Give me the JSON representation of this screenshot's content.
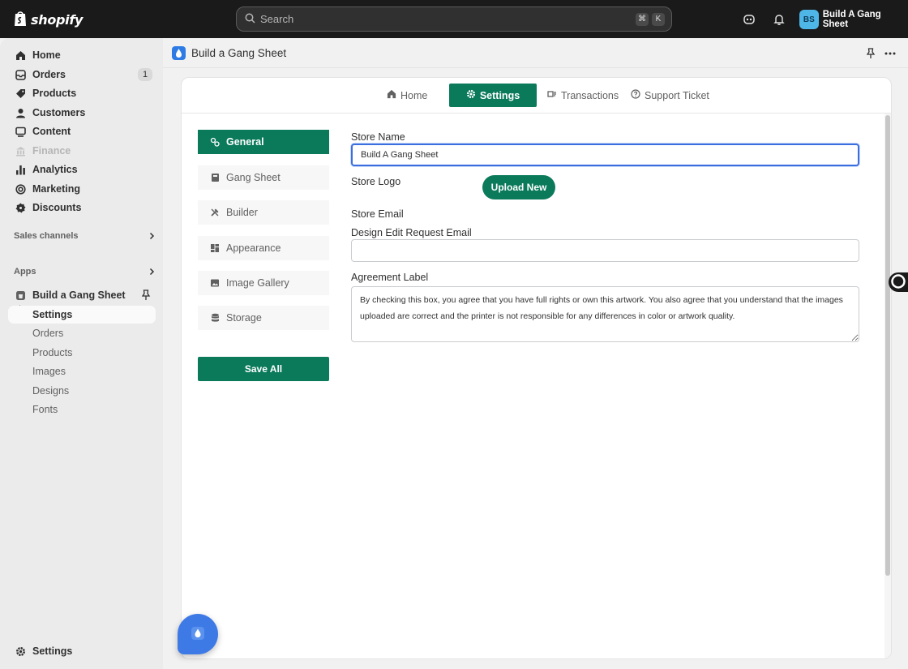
{
  "topbar": {
    "logo_text": "shopify",
    "search_placeholder": "Search",
    "shortcut_cmd": "⌘",
    "shortcut_key": "K",
    "account_initials": "BS",
    "account_name": "Build A Gang Sheet",
    "avatar_color": "#4fb6e8"
  },
  "sidebar": {
    "items": [
      {
        "label": "Home",
        "icon": "home-icon"
      },
      {
        "label": "Orders",
        "icon": "orders-icon",
        "badge": "1"
      },
      {
        "label": "Products",
        "icon": "tag-icon"
      },
      {
        "label": "Customers",
        "icon": "person-icon"
      },
      {
        "label": "Content",
        "icon": "content-icon"
      },
      {
        "label": "Finance",
        "icon": "bank-icon",
        "disabled": true
      },
      {
        "label": "Analytics",
        "icon": "bar-chart-icon"
      },
      {
        "label": "Marketing",
        "icon": "target-icon"
      },
      {
        "label": "Discounts",
        "icon": "discount-icon"
      }
    ],
    "sales_channels": "Sales channels",
    "apps": "Apps",
    "app_name": "Build a Gang Sheet",
    "app_subitems": [
      "Settings",
      "Orders",
      "Products",
      "Images",
      "Designs",
      "Fonts"
    ],
    "settings": "Settings"
  },
  "app_header": {
    "title": "Build a Gang Sheet"
  },
  "tabs": [
    {
      "label": "Home",
      "icon": "home-icon"
    },
    {
      "label": "Settings",
      "icon": "gear-icon",
      "active": true
    },
    {
      "label": "Transactions",
      "icon": "transactions-icon"
    },
    {
      "label": "Support Ticket",
      "icon": "question-icon"
    }
  ],
  "side_menu": [
    {
      "label": "General",
      "icon": "general-icon",
      "active": true
    },
    {
      "label": "Gang Sheet",
      "icon": "book-icon"
    },
    {
      "label": "Builder",
      "icon": "tools-icon"
    },
    {
      "label": "Appearance",
      "icon": "layout-icon"
    },
    {
      "label": "Image Gallery",
      "icon": "image-icon"
    },
    {
      "label": "Storage",
      "icon": "database-icon"
    }
  ],
  "save_all": "Save All",
  "form": {
    "store_name_label": "Store Name",
    "store_name_value": "Build A Gang Sheet",
    "store_logo_label": "Store Logo",
    "upload_new": "Upload New",
    "store_email_label": "Store Email",
    "design_email_label": "Design Edit Request Email",
    "design_email_value": "",
    "agreement_label": "Agreement Label",
    "agreement_value": "By checking this box, you agree that you have full rights or own this artwork. You also agree that you understand that the images uploaded are correct and the printer is not responsible for any differences in color or artwork quality."
  },
  "colors": {
    "accent": "#0b7a5b",
    "topbar": "#1a1a1a",
    "focus": "#3b6fe0",
    "app_blue": "#2f7be5"
  }
}
